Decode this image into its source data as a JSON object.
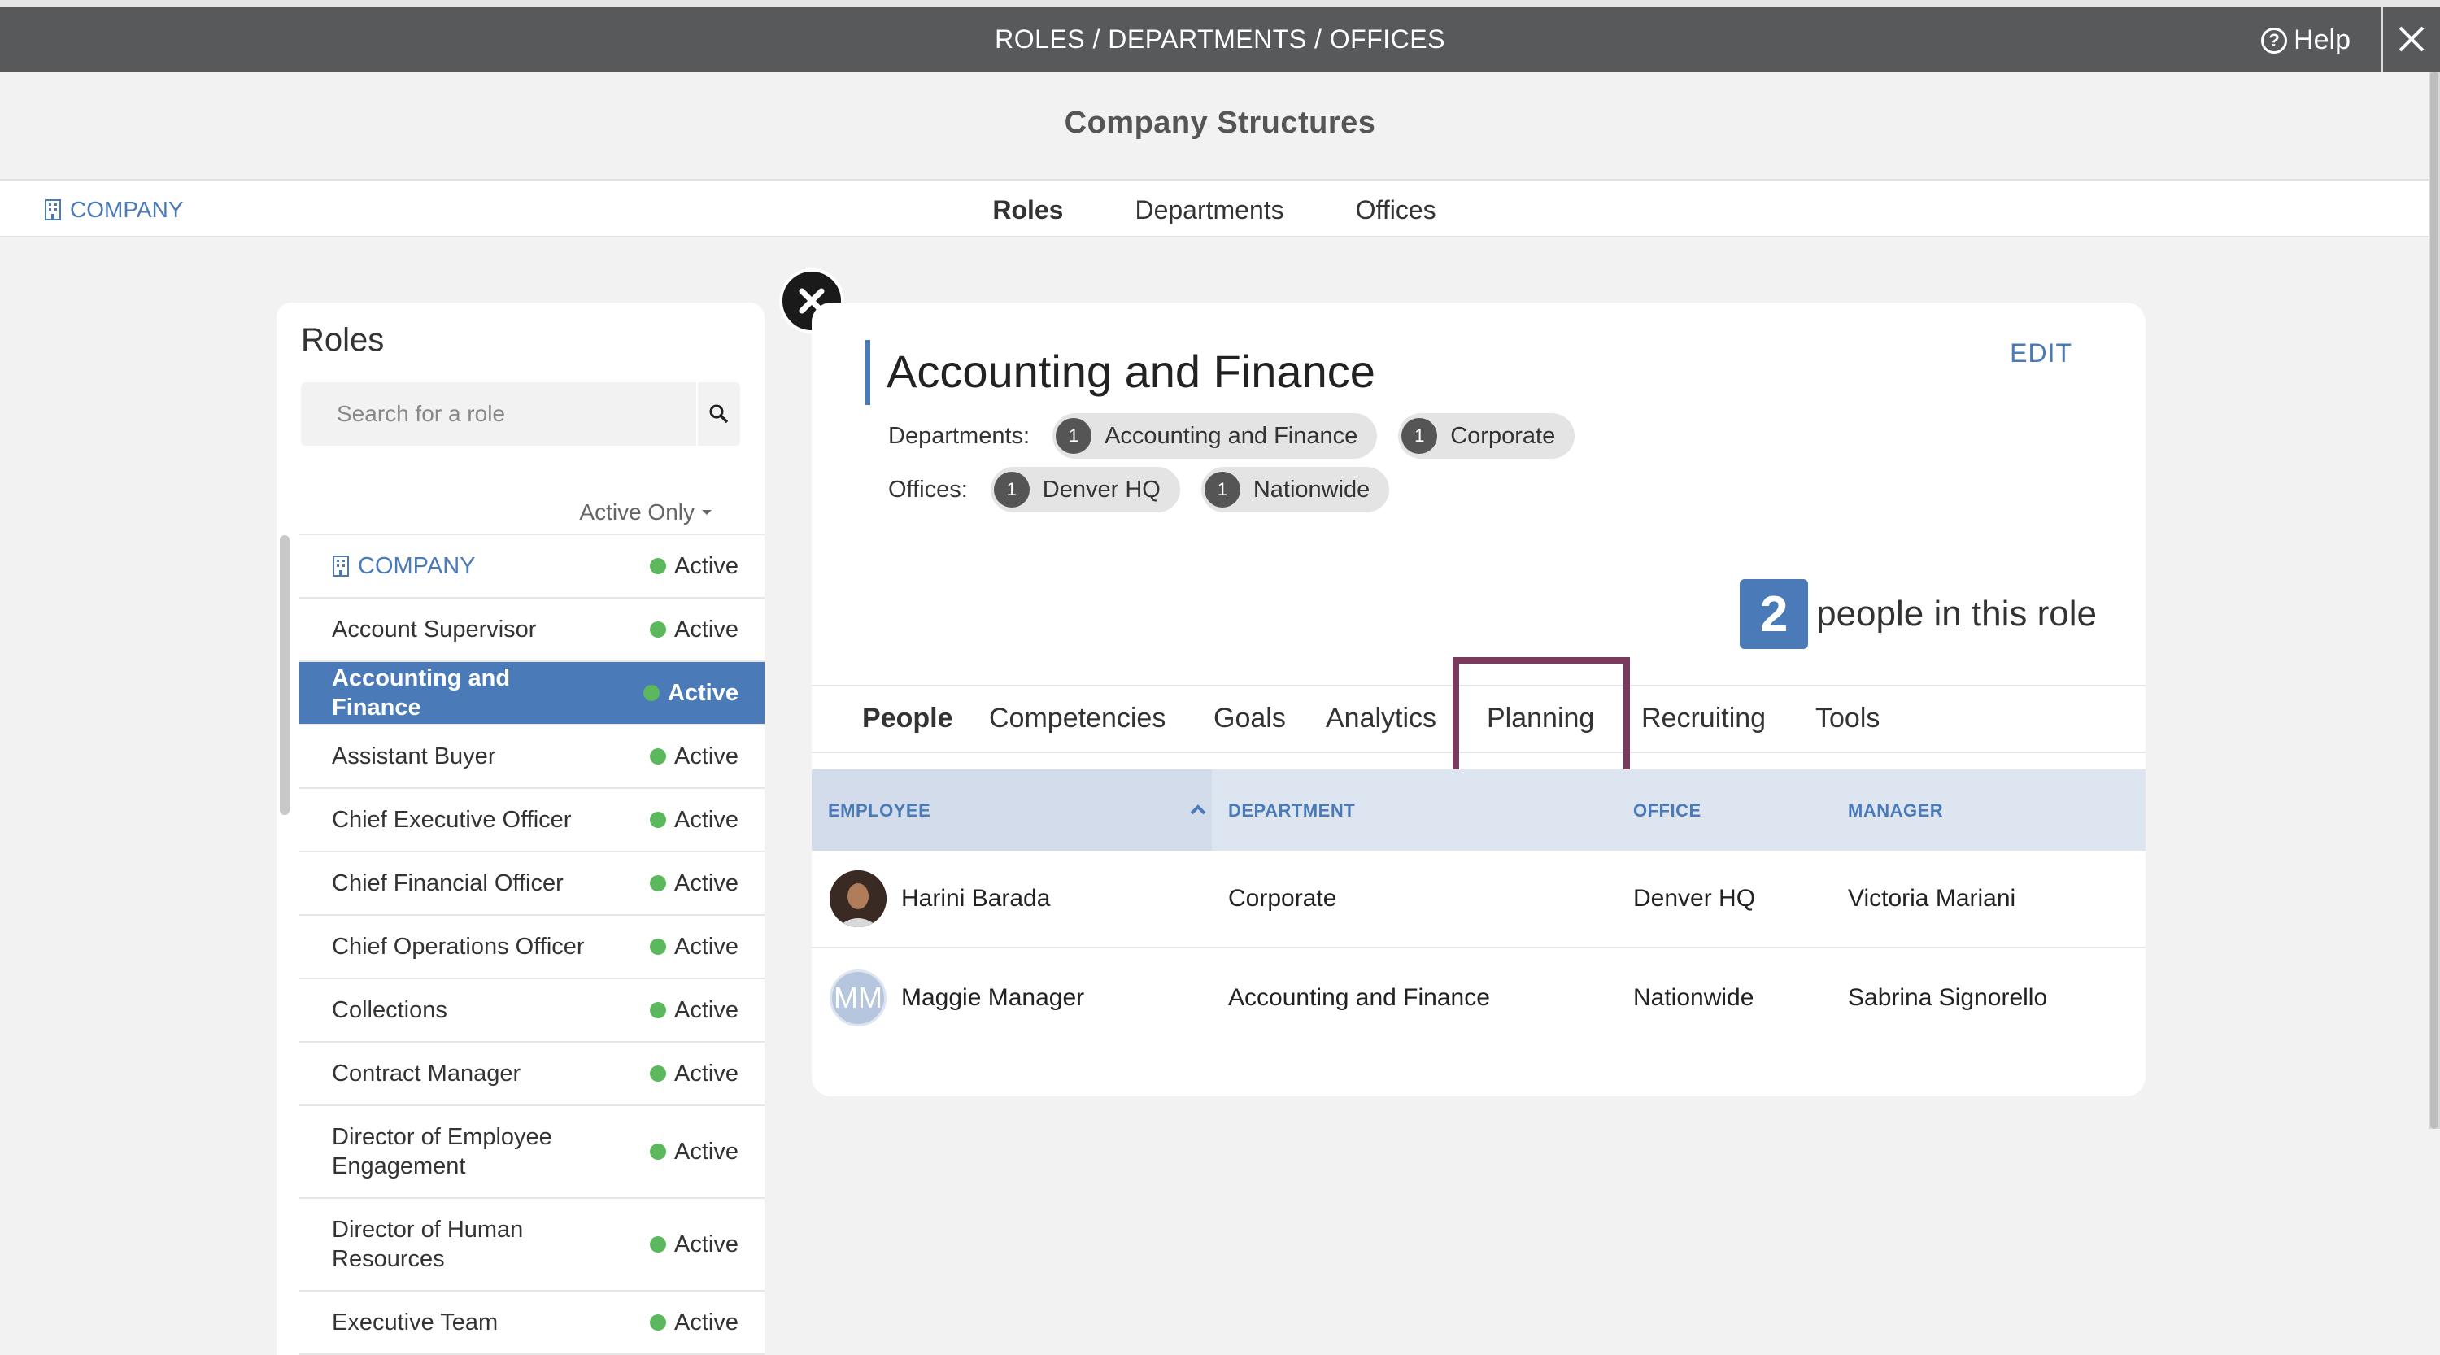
{
  "topbar": {
    "title": "ROLES / DEPARTMENTS / OFFICES",
    "help": "Help"
  },
  "page": {
    "title": "Company Structures"
  },
  "nav": {
    "company": "COMPANY",
    "tabs": [
      "Roles",
      "Departments",
      "Offices"
    ],
    "active_tab": "Roles"
  },
  "roles_panel": {
    "heading": "Roles",
    "search_placeholder": "Search for a role",
    "filter": "Active Only",
    "items": [
      {
        "name": "COMPANY",
        "status": "Active"
      },
      {
        "name": "Account Supervisor",
        "status": "Active"
      },
      {
        "name": "Accounting and Finance",
        "status": "Active"
      },
      {
        "name": "Assistant Buyer",
        "status": "Active"
      },
      {
        "name": "Chief Executive Officer",
        "status": "Active"
      },
      {
        "name": "Chief Financial Officer",
        "status": "Active"
      },
      {
        "name": "Chief Operations Officer",
        "status": "Active"
      },
      {
        "name": "Collections",
        "status": "Active"
      },
      {
        "name": "Contract Manager",
        "status": "Active"
      },
      {
        "name": "Director of Employee Engagement",
        "status": "Active"
      },
      {
        "name": "Director of Human Resources",
        "status": "Active"
      },
      {
        "name": "Executive Team",
        "status": "Active"
      }
    ]
  },
  "detail": {
    "title": "Accounting and Finance",
    "edit": "EDIT",
    "departments_label": "Departments:",
    "departments": [
      {
        "count": "1",
        "name": "Accounting and Finance"
      },
      {
        "count": "1",
        "name": "Corporate"
      }
    ],
    "offices_label": "Offices:",
    "offices": [
      {
        "count": "1",
        "name": "Denver HQ"
      },
      {
        "count": "1",
        "name": "Nationwide"
      }
    ],
    "people_count": "2",
    "people_text": "people in this role",
    "tabs": [
      "People",
      "Competencies",
      "Goals",
      "Analytics",
      "Planning",
      "Recruiting",
      "Tools"
    ],
    "active_tab": "People",
    "highlighted_tab": "Planning",
    "table": {
      "headers": [
        "EMPLOYEE",
        "DEPARTMENT",
        "OFFICE",
        "MANAGER"
      ],
      "rows": [
        {
          "employee": "Harini Barada",
          "department": "Corporate",
          "office": "Denver HQ",
          "manager": "Victoria Mariani",
          "avatar": "photo"
        },
        {
          "employee": "Maggie Manager",
          "department": "Accounting and Finance",
          "office": "Nationwide",
          "manager": "Sabrina Signorello",
          "avatar": "MM"
        }
      ]
    }
  },
  "colors": {
    "accent": "#4a7ab8",
    "topbar": "#58595b",
    "active_dot": "#5cb85c",
    "highlight": "#7a3a5e"
  }
}
